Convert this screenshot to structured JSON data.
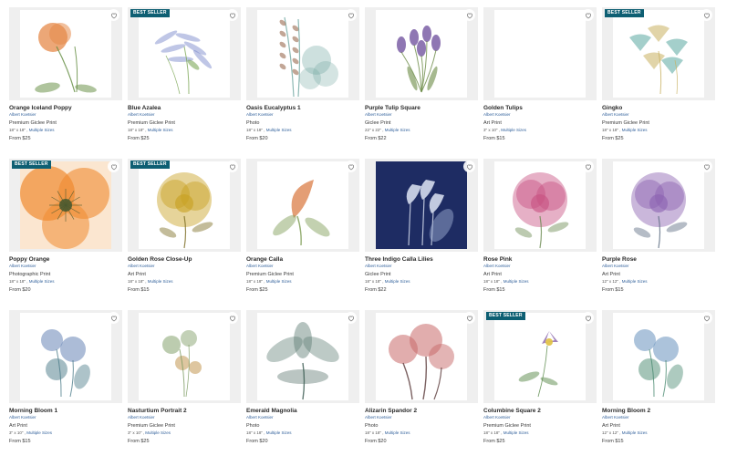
{
  "products": [
    {
      "title": "Orange Iceland Poppy",
      "artist": "Albert Koetsier",
      "type": "Premium Giclee Print",
      "size": "18\" x 18\"",
      "multiple": "Multiple Sizes",
      "price": "From $25",
      "badge": null,
      "image": "orange-poppy",
      "flower": "poppy",
      "colors": [
        "#e68a4a",
        "#5f8a3c"
      ]
    },
    {
      "title": "Blue Azalea",
      "artist": "Albert Koetsier",
      "type": "Premium Giclee Print",
      "size": "18\" x 18\"",
      "multiple": "Multiple Sizes",
      "price": "From $25",
      "badge": "BEST SELLER",
      "image": "blue-azalea",
      "flower": "azalea",
      "colors": [
        "#7080c8",
        "#7da858"
      ]
    },
    {
      "title": "Oasis Eucalyptus 1",
      "artist": "Albert Koetsier",
      "type": "Photo",
      "size": "18\" x 18\"",
      "multiple": "Multiple Sizes",
      "price": "From $20",
      "badge": null,
      "image": "eucalyptus",
      "flower": "eucalyptus",
      "colors": [
        "#9a6a50",
        "#6fa6a0"
      ]
    },
    {
      "title": "Purple Tulip Square",
      "artist": "Albert Koetsier",
      "type": "Giclee Print",
      "size": "22\" x 22\"",
      "multiple": "Multiple Sizes",
      "price": "From $22",
      "badge": null,
      "image": "purple-tulips",
      "flower": "tulips",
      "colors": [
        "#6a4a9a",
        "#6a8a45"
      ]
    },
    {
      "title": "Golden Tulips",
      "artist": "Albert Koetsier",
      "type": "Art Print",
      "size": "3\" x 10\"",
      "multiple": "Multiple Sizes",
      "price": "From $15",
      "badge": null,
      "image": "golden-tulips",
      "flower": "none",
      "colors": [
        "#d8b860",
        "#8a9a50"
      ]
    },
    {
      "title": "Gingko",
      "artist": "Albert Koetsier",
      "type": "Premium Giclee Print",
      "size": "18\" x 18\"",
      "multiple": "Multiple Sizes",
      "price": "From $25",
      "badge": "BEST SELLER",
      "image": "gingko",
      "flower": "gingko",
      "colors": [
        "#5aa8a0",
        "#c8b060"
      ]
    },
    {
      "title": "Poppy Orange",
      "artist": "Albert Koetsier",
      "type": "Photographic Print",
      "size": "18\" x 18\"",
      "multiple": "Multiple Sizes",
      "price": "From $20",
      "badge": "BEST SELLER",
      "image": "poppy-orange",
      "flower": "bigpoppy",
      "colors": [
        "#f08a30",
        "#4a5a30"
      ]
    },
    {
      "title": "Golden Rose Close-Up",
      "artist": "Albert Koetsier",
      "type": "Art Print",
      "size": "18\" x 18\"",
      "multiple": "Multiple Sizes",
      "price": "From $15",
      "badge": "BEST SELLER",
      "image": "golden-rose",
      "flower": "rose",
      "colors": [
        "#c8a020",
        "#7a6a20"
      ]
    },
    {
      "title": "Orange Calla",
      "artist": "Albert Koetsier",
      "type": "Premium Giclee Print",
      "size": "18\" x 18\"",
      "multiple": "Multiple Sizes",
      "price": "From $25",
      "badge": null,
      "image": "orange-calla",
      "flower": "calla",
      "colors": [
        "#d8753a",
        "#7a9a50"
      ]
    },
    {
      "title": "Three Indigo Calla Lilies",
      "artist": "Albert Koetsier",
      "type": "Giclee Print",
      "size": "18\" x 18\"",
      "multiple": "Multiple Sizes",
      "price": "From $22",
      "badge": null,
      "image": "indigo-calla",
      "flower": "indigo",
      "colors": [
        "#dfe6f5",
        "#9aaad0"
      ]
    },
    {
      "title": "Rose Pink",
      "artist": "Albert Koetsier",
      "type": "Art Print",
      "size": "18\" x 18\"",
      "multiple": "Multiple Sizes",
      "price": "From $15",
      "badge": null,
      "image": "rose-pink",
      "flower": "rose",
      "colors": [
        "#c85080",
        "#6a8a50"
      ]
    },
    {
      "title": "Purple Rose",
      "artist": "Albert Koetsier",
      "type": "Art Print",
      "size": "12\" x 12\"",
      "multiple": "Multiple Sizes",
      "price": "From $15",
      "badge": null,
      "image": "purple-rose",
      "flower": "rose",
      "colors": [
        "#8a60b0",
        "#5a6a80"
      ]
    },
    {
      "title": "Morning Bloom 1",
      "artist": "Albert Koetsier",
      "type": "Art Print",
      "size": "3\" x 10\"",
      "multiple": "Multiple Sizes",
      "price": "From $15",
      "badge": null,
      "image": "morning-bloom-1",
      "flower": "morning",
      "colors": [
        "#5a7ab0",
        "#4a7a88"
      ]
    },
    {
      "title": "Nasturtium Portrait 2",
      "artist": "Albert Koetsier",
      "type": "Premium Giclee Print",
      "size": "3\" x 10\"",
      "multiple": "Multiple Sizes",
      "price": "From $25",
      "badge": null,
      "image": "nasturtium",
      "flower": "nasturtium",
      "colors": [
        "#c8a060",
        "#7a9a60"
      ]
    },
    {
      "title": "Emerald Magnolia",
      "artist": "Albert Koetsier",
      "type": "Photo",
      "size": "18\" x 18\"",
      "multiple": "Multiple Sizes",
      "price": "From $20",
      "badge": null,
      "image": "emerald-magnolia",
      "flower": "magnolia",
      "colors": [
        "#5a7a70",
        "#3a5a50"
      ]
    },
    {
      "title": "Alizarin Spandor 2",
      "artist": "Albert Koetsier",
      "type": "Photo",
      "size": "18\" x 18\"",
      "multiple": "Multiple Sizes",
      "price": "From $20",
      "badge": null,
      "image": "alizarin",
      "flower": "alizarin",
      "colors": [
        "#c86a6a",
        "#5a3a3a"
      ]
    },
    {
      "title": "Columbine Square 2",
      "artist": "Albert Koetsier",
      "type": "Premium Giclee Print",
      "size": "18\" x 18\"",
      "multiple": "Multiple Sizes",
      "price": "From $25",
      "badge": "BEST SELLER",
      "image": "columbine",
      "flower": "columbine",
      "colors": [
        "#7a50a0",
        "#5a8a4a"
      ]
    },
    {
      "title": "Morning Bloom 2",
      "artist": "Albert Koetsier",
      "type": "Art Print",
      "size": "12\" x 12\"",
      "multiple": "Multiple Sizes",
      "price": "From $15",
      "badge": null,
      "image": "morning-bloom-2",
      "flower": "morning",
      "colors": [
        "#5a88b8",
        "#4a8a70"
      ]
    }
  ]
}
